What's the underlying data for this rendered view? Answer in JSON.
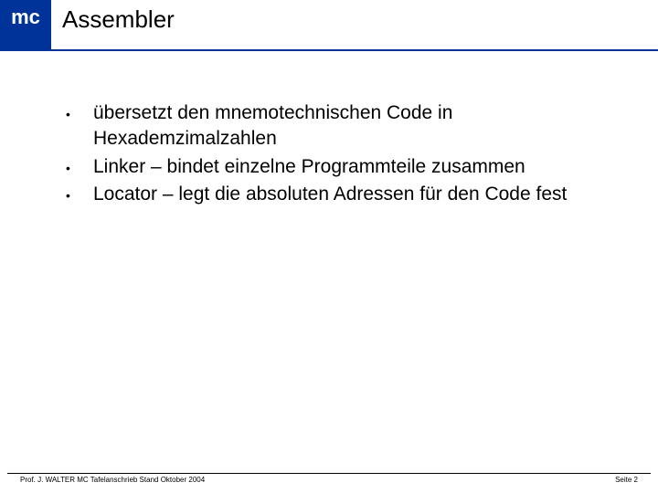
{
  "header": {
    "logo": "mc",
    "title": "Assembler"
  },
  "bullets": [
    "übersetzt den mnemotechnischen Code in Hexademzimalzahlen",
    "Linker – bindet einzelne Programmteile zusammen",
    "Locator – legt die absoluten Adressen für den Code fest"
  ],
  "footer": {
    "left": "Prof. J. WALTER   MC Tafelanschrieb   Stand Oktober 2004",
    "right": "Seite 2"
  }
}
